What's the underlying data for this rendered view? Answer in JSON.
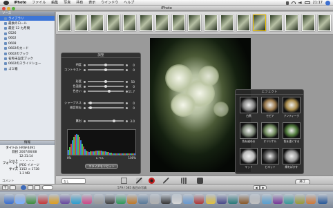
{
  "menubar": {
    "app_name": "iPhoto",
    "items": [
      "ファイル",
      "編集",
      "写真",
      "共有",
      "表示",
      "ウインドウ",
      "ヘルプ"
    ],
    "clock": "21:17"
  },
  "window": {
    "title": "iPhoto"
  },
  "sidebar": {
    "header": "ソース",
    "items": [
      {
        "label": "ライブラリ",
        "selected": true
      },
      {
        "label": "最後のロール",
        "selected": false
      },
      {
        "label": "最近 12 カ月間",
        "selected": false
      },
      {
        "label": "0526",
        "selected": false
      },
      {
        "label": "0602",
        "selected": false
      },
      {
        "label": "0608",
        "selected": false
      },
      {
        "label": "0602のカード",
        "selected": false
      },
      {
        "label": "0602のブック",
        "selected": false
      },
      {
        "label": "名称未設定ブック",
        "selected": false
      },
      {
        "label": "0602のスライドショー",
        "selected": false
      },
      {
        "label": "ゴミ箱",
        "selected": false
      }
    ]
  },
  "info": {
    "header": "情報",
    "rows": [
      {
        "k": "タイトル",
        "v": "HRSF4491"
      },
      {
        "k": "日付",
        "v": "2007/06/08"
      },
      {
        "k": "",
        "v": "12:31:14"
      },
      {
        "k": "レート",
        "v": "・・・・・"
      },
      {
        "k": "フォーマット",
        "v": "JPEG イメージ"
      },
      {
        "k": "サイズ",
        "v": "1152 × 1728"
      },
      {
        "k": "",
        "v": "1.2 MB"
      }
    ],
    "comment_label": "コメント"
  },
  "adjust": {
    "title": "調整",
    "sliders": [
      {
        "label": "明度",
        "value": "0",
        "pos": 0.5
      },
      {
        "label": "コントラスト",
        "value": "0",
        "pos": 0.5
      },
      {
        "label": "彩度",
        "value": "50",
        "pos": 0.5
      },
      {
        "label": "色温度",
        "value": "0",
        "pos": 0.5
      },
      {
        "label": "色合い",
        "value": "11.7",
        "pos": 0.6
      },
      {
        "label": "シャープネス",
        "value": "0",
        "pos": 0.05
      },
      {
        "label": "雑音除去",
        "value": "0",
        "pos": 0.05
      },
      {
        "label": "露出",
        "value": "3.0",
        "pos": 0.75
      }
    ],
    "hist_left": "0%",
    "hist_mid": "レベル",
    "hist_right": "100%",
    "reset_label": "スライダをリセット"
  },
  "effects": {
    "title": "エフェクト",
    "items": [
      "白黒",
      "セピア",
      "アンティーク",
      "色を褪める",
      "オリジナル",
      "色を濃くする",
      "マット",
      "ビネット",
      "縁をぼかす"
    ]
  },
  "toolbar": {
    "zoom_value": "なし",
    "rotate": "回転",
    "aspect": "縦横比の変更",
    "crop": "トリミング",
    "enhance": "補正",
    "redeye": "赤目",
    "retouch": "レタッチ",
    "effects": "エフェクト",
    "adjust": "調整",
    "done": "終了"
  },
  "status": {
    "count": "579 / 585 枚目の写真"
  },
  "colors": {
    "selection": "#3d75d6",
    "panel": "#2a2a2a",
    "menubar": "#e8e8e8"
  }
}
